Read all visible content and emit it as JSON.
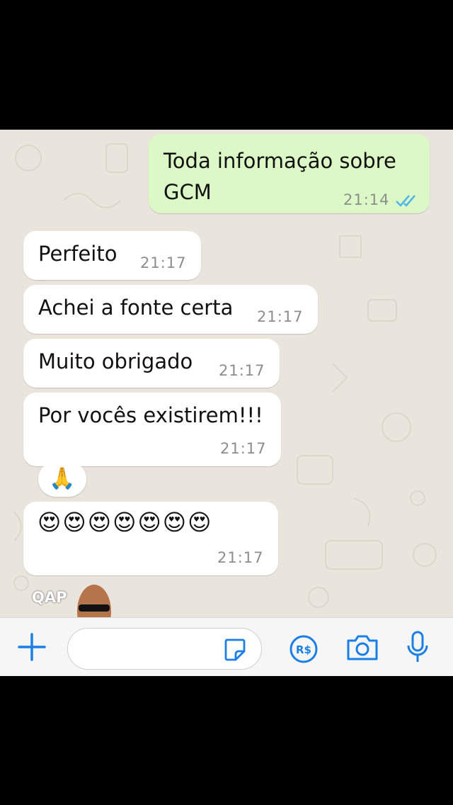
{
  "messages": [
    {
      "direction": "out",
      "text_line1": "Toda informação sobre",
      "text_line2": "GCM",
      "time": "21:14",
      "status": "read"
    },
    {
      "direction": "in",
      "text": "Perfeito",
      "time": "21:17"
    },
    {
      "direction": "in",
      "text": "Achei a fonte certa",
      "time": "21:17"
    },
    {
      "direction": "in",
      "text": "Muito obrigado",
      "time": "21:17"
    },
    {
      "direction": "in",
      "text": "Por vocês existirem!!!",
      "time": "21:17"
    },
    {
      "direction": "in",
      "emojis": "😍😍😍😍😍😍😍",
      "time": "21:17"
    }
  ],
  "reaction": "🙏",
  "sticker_text": "QAP",
  "input": {
    "placeholder": "",
    "value": ""
  },
  "icons": [
    "plus-icon",
    "sticker-icon",
    "payment-icon",
    "camera-icon",
    "microphone-icon",
    "double-check-icon"
  ],
  "colors": {
    "accent": "#1a7fe6",
    "outgoing_bubble": "#dcf8c6",
    "incoming_bubble": "#ffffff",
    "read_ticks": "#4fb6ec"
  }
}
